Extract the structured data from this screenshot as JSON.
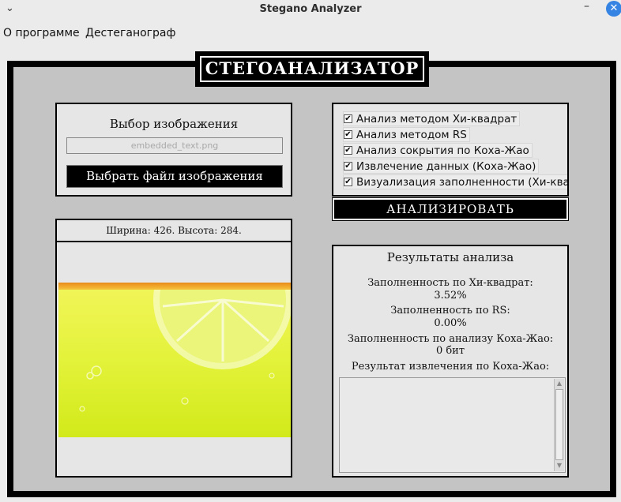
{
  "window": {
    "title": "Stegano Analyzer",
    "menu_icon": "chevron-down",
    "minimize_icon": "minimize",
    "close_icon": "close",
    "close_color": "#3584e4"
  },
  "menu": {
    "items": [
      {
        "label": "О программе"
      },
      {
        "label": "Дестеганограф"
      }
    ]
  },
  "main": {
    "heading": "СТЕГОАНАЛИЗАТОР",
    "select_panel": {
      "label": "Выбор изображения",
      "file_placeholder": "embedded_text.png",
      "choose_button": "Выбрать файл изображения"
    },
    "checks": [
      {
        "label": "Анализ методом Хи-квадрат",
        "checked": true
      },
      {
        "label": "Анализ методом RS",
        "checked": true
      },
      {
        "label": "Анализ сокрытия по Коха-Жао",
        "checked": true
      },
      {
        "label": "Извлечение данных (Коха-Жао)",
        "checked": true
      },
      {
        "label": "Визуализация заполненности (Хи-квадрат)",
        "checked": true
      }
    ],
    "analyze_button": "АНАЛИЗИРОВАТЬ",
    "image_panel": {
      "dimensions": "Ширина: 426. Высота: 284."
    },
    "results": {
      "title": "Результаты анализа",
      "chi_label": "Заполненность по Хи-квадрат:",
      "chi_value": "3.52%",
      "rs_label": "Заполненность по RS:",
      "rs_value": "0.00%",
      "koch_label": "Заполненность по анализу Коха-Жао:",
      "koch_value": "0 бит",
      "extract_label": "Результат извлечения по Коха-Жао:",
      "extract_text": ""
    }
  }
}
